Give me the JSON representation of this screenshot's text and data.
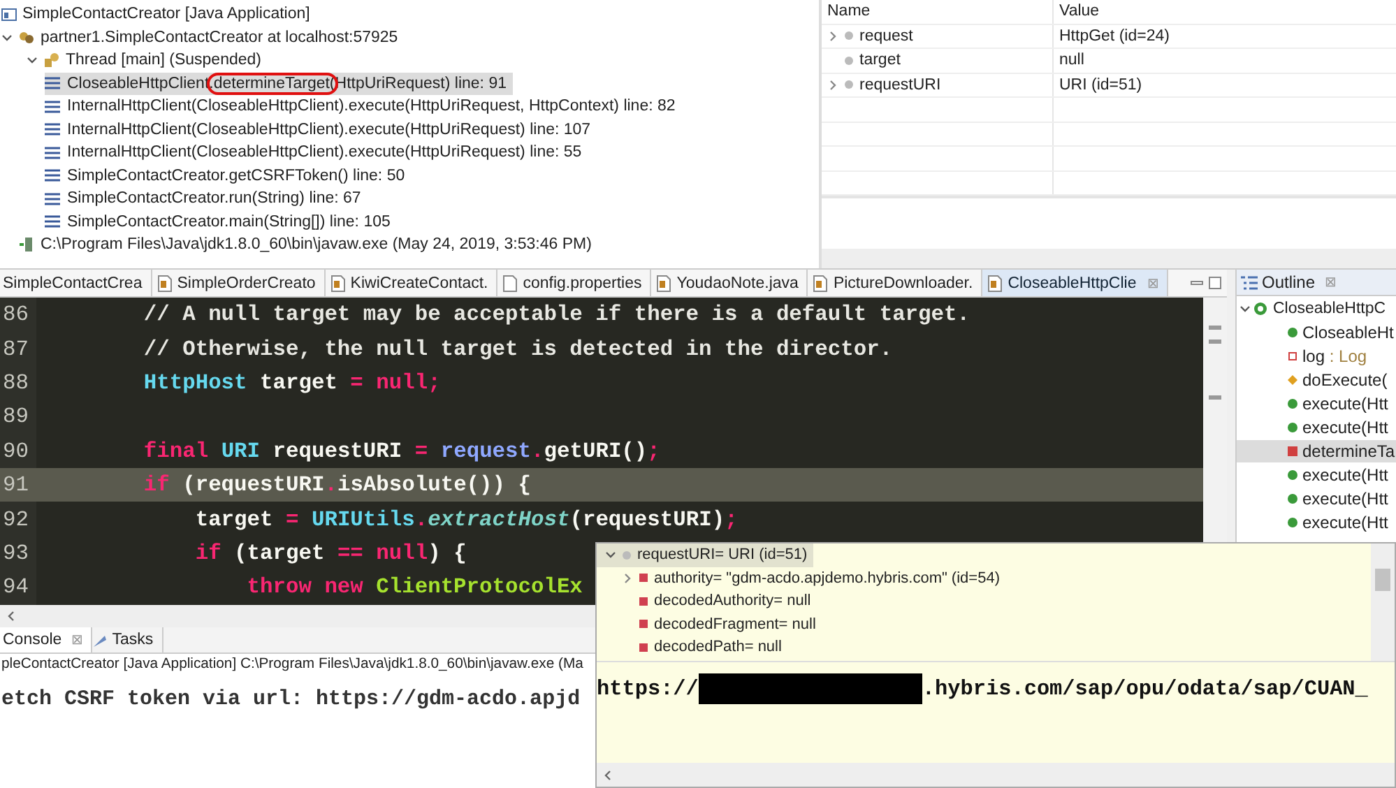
{
  "debug_tree": {
    "launch": {
      "label": "SimpleContactCreator [Java Application]",
      "children": [
        {
          "label": "partner1.SimpleContactCreator at localhost:57925",
          "kind": "target",
          "expanded": true,
          "children": [
            {
              "label": "Thread [main] (Suspended)",
              "kind": "thread",
              "expanded": true,
              "frames": [
                {
                  "selected": true,
                  "segments": [
                    {
                      "text": "CloseableHttpClient",
                      "circled": false
                    },
                    {
                      "text": ".determineTarget(",
                      "circled": true
                    },
                    {
                      "text": "HttpUriRequest) line: 91",
                      "circled": false
                    }
                  ]
                },
                {
                  "selected": false,
                  "segments": [
                    {
                      "text": "InternalHttpClient(CloseableHttpClient).execute(HttpUriRequest, HttpContext) line: 82",
                      "circled": false
                    }
                  ]
                },
                {
                  "selected": false,
                  "segments": [
                    {
                      "text": "InternalHttpClient(CloseableHttpClient).execute(HttpUriRequest) line: 107",
                      "circled": false
                    }
                  ]
                },
                {
                  "selected": false,
                  "segments": [
                    {
                      "text": "InternalHttpClient(CloseableHttpClient).execute(HttpUriRequest) line: 55",
                      "circled": false
                    }
                  ]
                },
                {
                  "selected": false,
                  "segments": [
                    {
                      "text": "SimpleContactCreator.getCSRFToken() line: 50",
                      "circled": false
                    }
                  ]
                },
                {
                  "selected": false,
                  "segments": [
                    {
                      "text": "SimpleContactCreator.run(String) line: 67",
                      "circled": false
                    }
                  ]
                },
                {
                  "selected": false,
                  "segments": [
                    {
                      "text": "SimpleContactCreator.main(String[]) line: 105",
                      "circled": false
                    }
                  ]
                }
              ]
            }
          ]
        },
        {
          "label": "C:\\Program Files\\Java\\jdk1.8.0_60\\bin\\javaw.exe (May 24, 2019, 3:53:46 PM)",
          "kind": "process"
        }
      ]
    }
  },
  "variables": {
    "columns": [
      "Name",
      "Value"
    ],
    "rows": [
      {
        "name": "request",
        "value": "HttpGet  (id=24)",
        "expandable": true
      },
      {
        "name": "target",
        "value": "null",
        "expandable": false
      },
      {
        "name": "requestURI",
        "value": "URI  (id=51)",
        "expandable": true
      }
    ]
  },
  "editor_tabs": [
    {
      "label": "SimpleContactCrea",
      "selected": false
    },
    {
      "label": "SimpleOrderCreato",
      "selected": false
    },
    {
      "label": "KiwiCreateContact.",
      "selected": false
    },
    {
      "label": "config.properties",
      "selected": false,
      "kind": "properties"
    },
    {
      "label": "YoudaoNote.java",
      "selected": false
    },
    {
      "label": "PictureDownloader.",
      "selected": false
    },
    {
      "label": "CloseableHttpClie",
      "selected": true,
      "close": "⊠"
    }
  ],
  "code": [
    {
      "number": "86",
      "current": false,
      "tokens": [
        {
          "kind": "comment",
          "text": "        // A null target may be acceptable if there is a default target."
        }
      ]
    },
    {
      "number": "87",
      "current": false,
      "tokens": [
        {
          "kind": "comment",
          "text": "        // Otherwise, the null target is detected in the director."
        }
      ]
    },
    {
      "number": "88",
      "current": false,
      "tokens": [
        {
          "kind": "type",
          "text": "        HttpHost"
        },
        {
          "kind": "plain",
          "text": " target "
        },
        {
          "kind": "keyword",
          "text": "= null;"
        }
      ]
    },
    {
      "number": "89",
      "current": false
    },
    {
      "number": "90",
      "current": false,
      "tokens": [
        {
          "kind": "keyword",
          "text": "        final"
        },
        {
          "kind": "type",
          "text": " URI"
        },
        {
          "kind": "plain",
          "text": " requestURI "
        },
        {
          "kind": "keyword",
          "text": "="
        },
        {
          "kind": "field",
          "text": " request"
        },
        {
          "kind": "keyword",
          "text": "."
        },
        {
          "kind": "plain",
          "text": "getURI()"
        },
        {
          "kind": "keyword",
          "text": ";"
        }
      ]
    },
    {
      "number": "91",
      "current": true,
      "tokens": [
        {
          "kind": "keyword",
          "text": "        if"
        },
        {
          "kind": "plain",
          "text": " (requestURI"
        },
        {
          "kind": "keyword",
          "text": "."
        },
        {
          "kind": "plain",
          "text": "isAbsolute()) {"
        }
      ]
    },
    {
      "number": "92",
      "current": false,
      "tokens": [
        {
          "kind": "plain",
          "text": "            target "
        },
        {
          "kind": "keyword",
          "text": "="
        },
        {
          "kind": "type",
          "text": " URIUtils"
        },
        {
          "kind": "keyword",
          "text": "."
        },
        {
          "kind": "static",
          "text": "extractHost"
        },
        {
          "kind": "plain",
          "text": "(requestURI)"
        },
        {
          "kind": "keyword",
          "text": ";"
        }
      ]
    },
    {
      "number": "93",
      "current": false,
      "tokens": [
        {
          "kind": "keyword",
          "text": "            if"
        },
        {
          "kind": "plain",
          "text": " (target "
        },
        {
          "kind": "keyword",
          "text": "== null"
        },
        {
          "kind": "plain",
          "text": ") {"
        }
      ]
    },
    {
      "number": "94",
      "current": false,
      "tokens": [
        {
          "kind": "keyword",
          "text": "                throw new"
        },
        {
          "kind": "class",
          "text": " ClientProtocolEx"
        }
      ]
    }
  ],
  "outline": {
    "title": "Outline",
    "close": "⊠",
    "root": {
      "name": "CloseableHttpC",
      "expanded": true,
      "children": [
        {
          "name": "CloseableHt",
          "kind": "constructor",
          "selected": false
        },
        {
          "name": "log",
          "type_label": " : Log",
          "kind": "field",
          "selected": false
        },
        {
          "name": "doExecute(",
          "kind": "abstract",
          "selected": false
        },
        {
          "name": "execute(Htt",
          "kind": "public",
          "selected": false
        },
        {
          "name": "execute(Htt",
          "kind": "public",
          "selected": false
        },
        {
          "name": "determineTa",
          "kind": "private",
          "selected": true
        },
        {
          "name": "execute(Htt",
          "kind": "public",
          "selected": false
        },
        {
          "name": "execute(Htt",
          "kind": "public",
          "selected": false
        },
        {
          "name": "execute(Htt",
          "kind": "public",
          "selected": false
        }
      ]
    }
  },
  "console": {
    "tabs": [
      {
        "label": "Console",
        "selected": true,
        "close": "⊠"
      },
      {
        "label": "Tasks",
        "selected": false
      }
    ],
    "header": "pleContactCreator [Java Application] C:\\Program Files\\Java\\jdk1.8.0_60\\bin\\javaw.exe (Ma",
    "output": "etch CSRF token via url: https://gdm-acdo.apjd"
  },
  "hover": {
    "root": {
      "label": "requestURI= URI  (id=51)",
      "expanded": true,
      "selected": true
    },
    "children": [
      {
        "label": "authority= \"gdm-acdo.apjdemo.hybris.com\" (id=54)",
        "expandable": true
      },
      {
        "label": "decodedAuthority= null",
        "expandable": false
      },
      {
        "label": "decodedFragment= null",
        "expandable": false
      },
      {
        "label": "decodedPath= null",
        "expandable": false
      }
    ],
    "detail_prefix": "https://",
    "detail_redacted": true,
    "detail_suffix": ".hybris.com/sap/opu/odata/sap/CUAN_"
  }
}
